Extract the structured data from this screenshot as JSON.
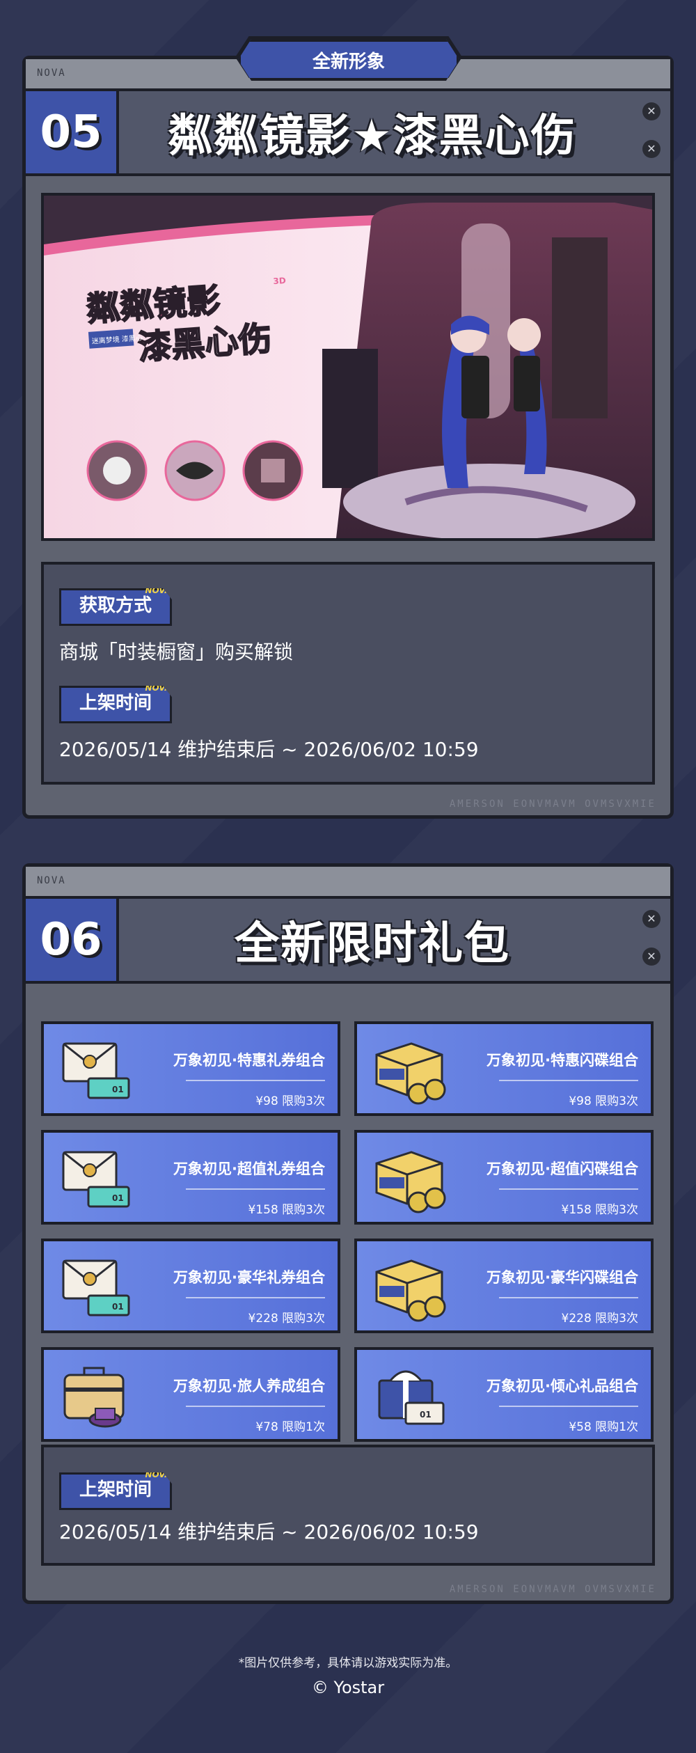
{
  "top_tag": "全新形象",
  "section1": {
    "corner_label": "NOVA",
    "number": "05",
    "title": "粼粼镜影★漆黑心伤",
    "banner": {
      "logo_line1": "粼粼镜影",
      "logo_line2": "漆黑心伤",
      "logo_small": "迷离梦境 漆黑心",
      "logo_badge": "3D"
    },
    "method_label": "获取方式",
    "method_text": "商城「时装橱窗」购买解锁",
    "time_label": "上架时间",
    "time_text": "2026/05/14 维护结束后 ~ 2026/06/02 10:59",
    "label_deco": "NOVA",
    "footer_faint": "AMERSON EONVMAVM OVMSVXMIE"
  },
  "section2": {
    "corner_label": "NOVA",
    "number": "06",
    "title": "全新限时礼包",
    "cards": [
      {
        "name": "万象初见·特惠礼券组合",
        "price": "¥98 限购3次",
        "icon": "envelope-ticket-icon"
      },
      {
        "name": "万象初见·特惠闪碟组合",
        "price": "¥98 限购3次",
        "icon": "box-disc-icon"
      },
      {
        "name": "万象初见·超值礼券组合",
        "price": "¥158 限购3次",
        "icon": "envelope-ticket-icon"
      },
      {
        "name": "万象初见·超值闪碟组合",
        "price": "¥158 限购3次",
        "icon": "box-disc-icon"
      },
      {
        "name": "万象初见·豪华礼券组合",
        "price": "¥228 限购3次",
        "icon": "envelope-ticket-icon"
      },
      {
        "name": "万象初见·豪华闪碟组合",
        "price": "¥228 限购3次",
        "icon": "box-disc-icon"
      },
      {
        "name": "万象初见·旅人养成组合",
        "price": "¥78 限购1次",
        "icon": "suitcase-icon"
      },
      {
        "name": "万象初见·倾心礼品组合",
        "price": "¥58 限购1次",
        "icon": "gift-box-icon"
      }
    ],
    "time_label": "上架时间",
    "time_text": "2026/05/14 维护结束后 ~ 2026/06/02 10:59",
    "label_deco": "NOVA",
    "footer_faint": "AMERSON EONVMAVM OVMSVXMIE"
  },
  "footer": {
    "disclaimer": "*图片仅供参考，具体请以游戏实际为准。",
    "copyright": "© Yostar"
  },
  "colors": {
    "background": "#2b3150",
    "accent_blue": "#3e53a8",
    "card_blue": "#6f8ae6",
    "panel_grey": "#5f6370",
    "outline": "#1c1e27"
  }
}
